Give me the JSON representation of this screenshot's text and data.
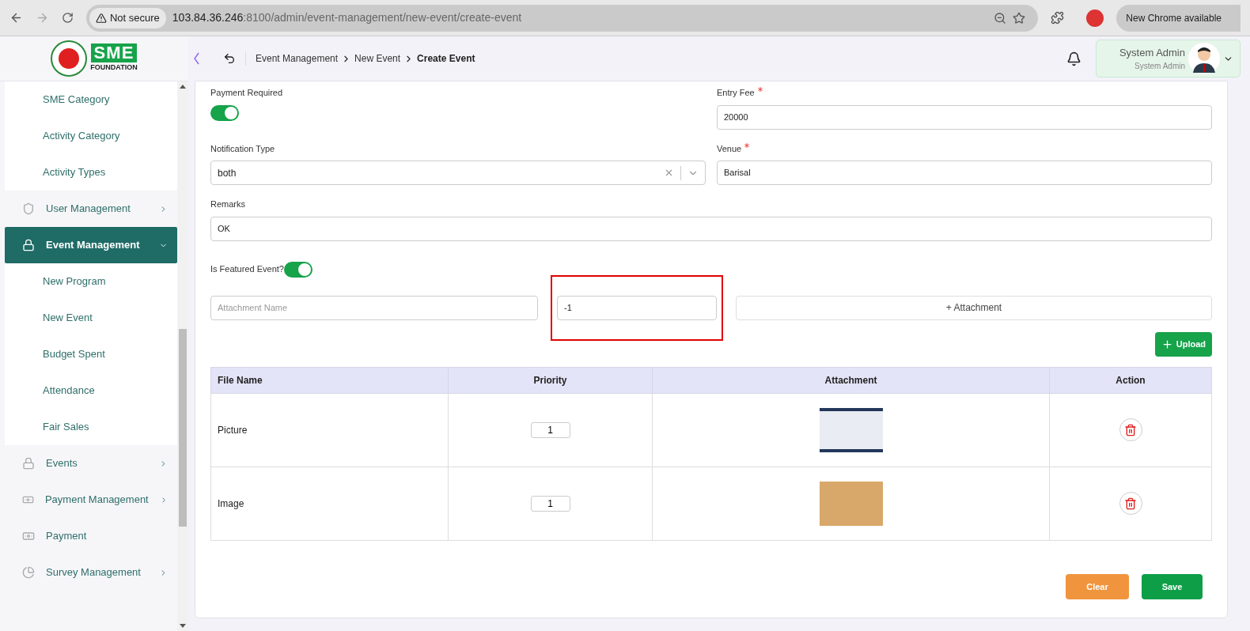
{
  "browser": {
    "security": "Not secure",
    "url_host": "103.84.36.246",
    "url_rest": ":8100/admin/event-management/new-event/create-event",
    "update": "New Chrome available"
  },
  "header": {
    "breadcrumb": [
      {
        "label": "Event Management",
        "current": false
      },
      {
        "label": "New Event",
        "current": false
      },
      {
        "label": "Create Event",
        "current": true
      }
    ],
    "user_name": "System Admin",
    "user_role": "System Admin"
  },
  "logo": {
    "text": "SME",
    "subtext": "FOUNDATION"
  },
  "sidebar": [
    {
      "kind": "sub",
      "label": "SME Category",
      "selected": false
    },
    {
      "kind": "sub",
      "label": "Activity Category",
      "selected": false
    },
    {
      "kind": "sub",
      "label": "Activity Types",
      "selected": false
    },
    {
      "kind": "group",
      "label": "User Management",
      "selected": false,
      "expanded": false
    },
    {
      "kind": "group",
      "label": "Event Management",
      "selected": true,
      "expanded": true
    },
    {
      "kind": "sub",
      "label": "New Program",
      "selected": false
    },
    {
      "kind": "sub",
      "label": "New Event",
      "selected": false
    },
    {
      "kind": "sub",
      "label": "Budget Spent",
      "selected": false
    },
    {
      "kind": "sub",
      "label": "Attendance",
      "selected": false
    },
    {
      "kind": "sub",
      "label": "Fair Sales",
      "selected": false
    },
    {
      "kind": "group",
      "label": "Events",
      "selected": false,
      "expanded": false
    },
    {
      "kind": "group",
      "label": "Payment Management",
      "selected": false,
      "expanded": false
    },
    {
      "kind": "leaf",
      "label": "Payment",
      "selected": false
    },
    {
      "kind": "group",
      "label": "Survey Management",
      "selected": false,
      "expanded": false
    }
  ],
  "form": {
    "payment_required": {
      "label": "Payment Required",
      "on": true
    },
    "entry_fee": {
      "label": "Entry Fee",
      "required": true,
      "value": "20000"
    },
    "notification_type": {
      "label": "Notification Type",
      "required": false,
      "value": "both"
    },
    "venue": {
      "label": "Venue",
      "required": true,
      "value": "Barisal"
    },
    "remarks": {
      "label": "Remarks",
      "required": false,
      "value": "OK"
    },
    "featured": {
      "label": "Is Featured Event?",
      "on": true
    }
  },
  "attachment": {
    "name_placeholder": "Attachment Name",
    "priority_value": "-1",
    "highlighted": true,
    "add_button": "+ Attachment",
    "upload_button": "Upload"
  },
  "table": {
    "columns": [
      "File Name",
      "Priority",
      "Attachment",
      "Action"
    ],
    "rows": [
      {
        "file_name": "Picture",
        "priority": "1"
      },
      {
        "file_name": "Image",
        "priority": "1"
      }
    ]
  },
  "buttons": {
    "clear": "Clear",
    "save": "Save"
  }
}
